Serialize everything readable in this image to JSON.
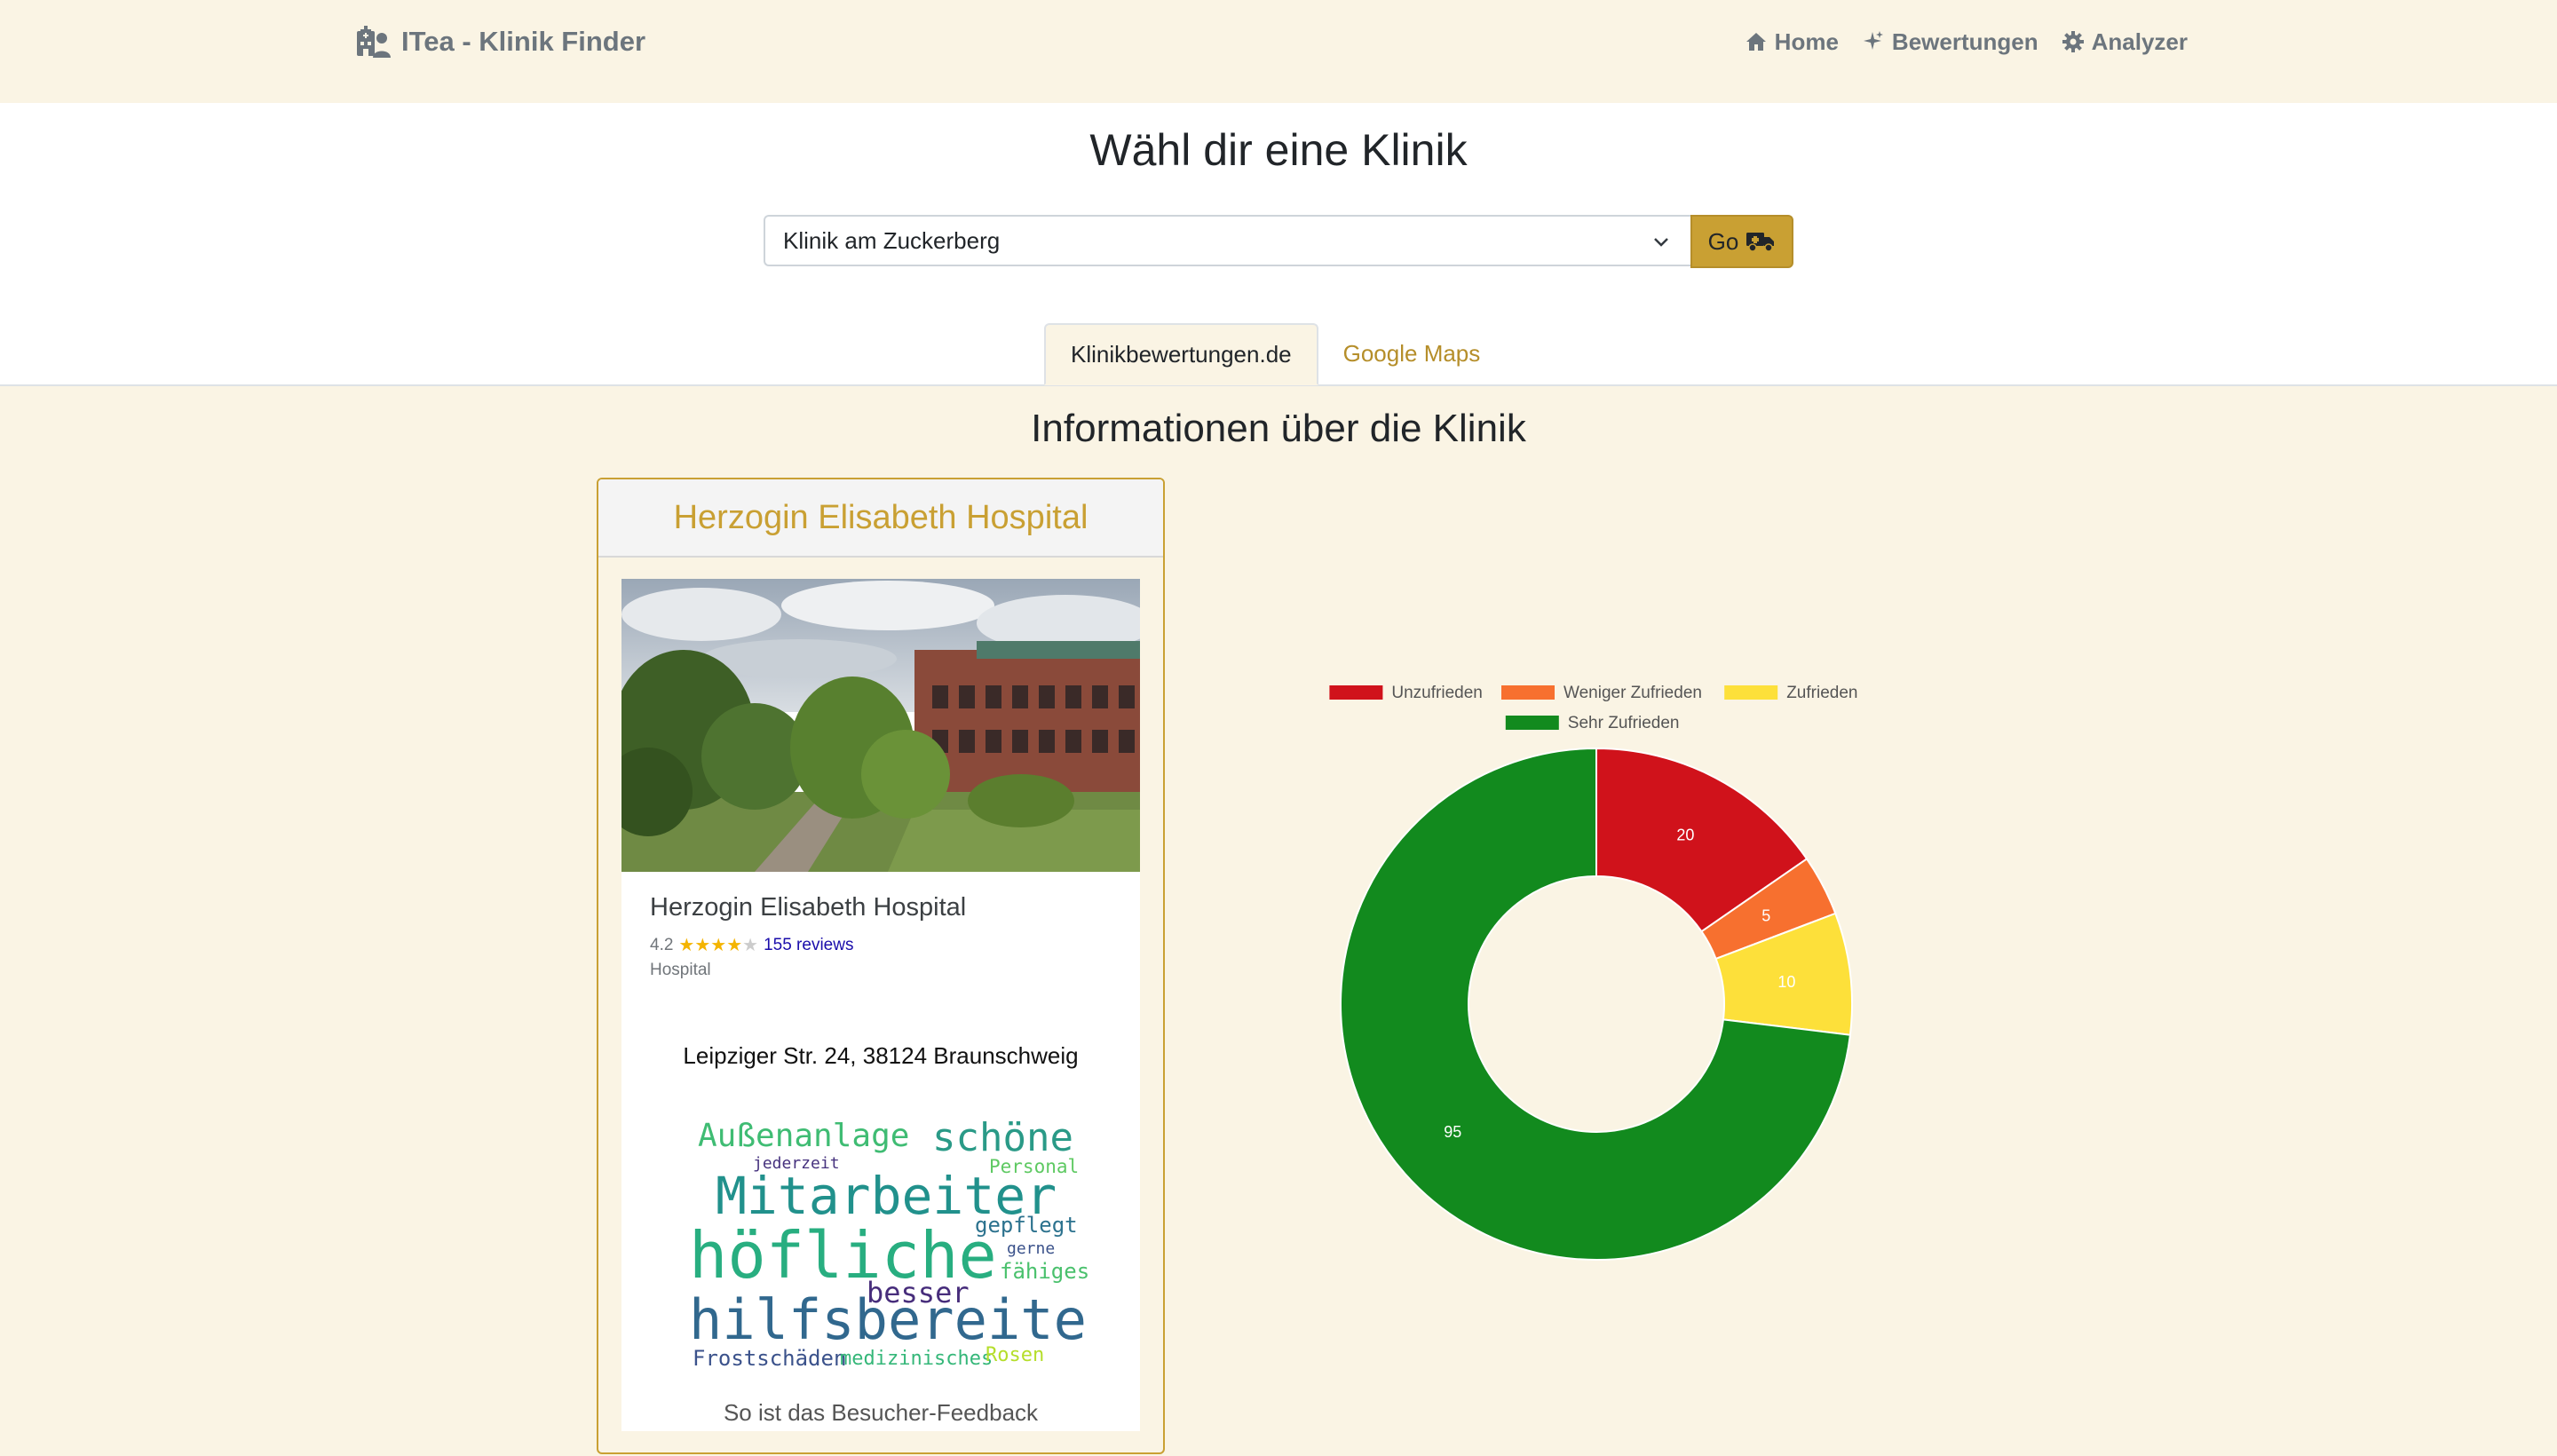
{
  "nav": {
    "brand": "ITea - Klinik Finder",
    "links": [
      {
        "label": "Home",
        "icon": "home-icon"
      },
      {
        "label": "Bewertungen",
        "icon": "sparkles-icon"
      },
      {
        "label": "Analyzer",
        "icon": "gear-icon"
      }
    ]
  },
  "header": {
    "title": "Wähl dir eine Klinik",
    "select_value": "Klinik am Zuckerberg",
    "go_label": "Go",
    "tabs": [
      {
        "label": "Klinikbewertungen.de",
        "active": true
      },
      {
        "label": "Google Maps",
        "active": false
      }
    ]
  },
  "section": {
    "title": "Informationen über die Klinik"
  },
  "clinic": {
    "card_title": "Herzogin Elisabeth Hospital",
    "gmaps_name": "Herzogin Elisabeth Hospital",
    "rating": "4.2",
    "stars_filled": 4,
    "reviews": "155 reviews",
    "type": "Hospital",
    "address": "Leipziger Str. 24, 38124 Braunschweig",
    "footer": "So ist das Besucher-Feedback"
  },
  "wordcloud": {
    "words": [
      {
        "text": "Außenanlage",
        "color": "#3fbc73"
      },
      {
        "text": "schöne",
        "color": "#2a9a87"
      },
      {
        "text": "jederzeit",
        "color": "#46327e"
      },
      {
        "text": "Personal",
        "color": "#5ec962"
      },
      {
        "text": "Mitarbeiter",
        "color": "#21918c"
      },
      {
        "text": "gepflegt",
        "color": "#2c728e"
      },
      {
        "text": "höfliche",
        "color": "#28ae80"
      },
      {
        "text": "gerne",
        "color": "#3b528b"
      },
      {
        "text": "fähiges",
        "color": "#4ac16d"
      },
      {
        "text": "besser",
        "color": "#472d7b"
      },
      {
        "text": "hilfsbereite",
        "color": "#31688e"
      },
      {
        "text": "Frostschäden",
        "color": "#3b528b"
      },
      {
        "text": "medizinisches",
        "color": "#35b779"
      },
      {
        "text": "Rosen",
        "color": "#b5de2b"
      }
    ]
  },
  "colors": {
    "accent": "#c9a033",
    "background": "#faf4e4"
  },
  "chart_data": {
    "type": "doughnut",
    "categories": [
      "Unzufrieden",
      "Weniger Zufrieden",
      "Zufrieden",
      "Sehr Zufrieden"
    ],
    "values": [
      20,
      5,
      10,
      95
    ],
    "colors": [
      "#d0121b",
      "#f7702f",
      "#fde03a",
      "#128a1e"
    ],
    "legend_position": "top"
  }
}
